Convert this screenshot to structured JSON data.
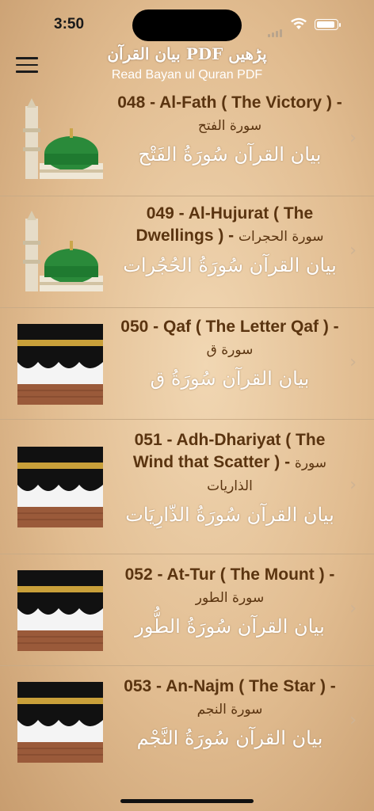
{
  "status": {
    "time": "3:50"
  },
  "header": {
    "title_urdu": "بیان القرآن PDF پڑھیں",
    "subtitle": "Read Bayan ul Quran PDF",
    "menu_icon": "hamburger-menu-icon"
  },
  "surahs": [
    {
      "title": "048 - Al-Fath ( The Victory ) - ",
      "arabic": "سورة الفتح",
      "calligraphy": "بیان القرآن سُورَةُ الفَتْح",
      "image": "green-dome-icon"
    },
    {
      "title": "049 - Al-Hujurat ( The Dwellings ) - ",
      "arabic": "سورة الحجرات",
      "calligraphy": "بیان القرآن سُورَةُ الحُجُرات",
      "image": "green-dome-icon"
    },
    {
      "title": "050 - Qaf ( The Letter Qaf ) - ",
      "arabic": "سورة ق",
      "calligraphy": "بیان القرآن سُورَةُ ق",
      "image": "kaaba-icon"
    },
    {
      "title": "051 - Adh-Dhariyat ( The Wind that Scatter ) - ",
      "arabic": "سورة الذاريات",
      "calligraphy": "بیان القرآن سُورَةُ الذّارِيَات",
      "image": "kaaba-icon"
    },
    {
      "title": "052 - At-Tur ( The Mount ) - ",
      "arabic": "سورة الطور",
      "calligraphy": "بیان القرآن سُورَةُ الطُّور",
      "image": "kaaba-icon"
    },
    {
      "title": "053 - An-Najm ( The Star ) - ",
      "arabic": "سورة النجم",
      "calligraphy": "بیان القرآن سُورَةُ النَّجْم",
      "image": "kaaba-icon"
    }
  ]
}
